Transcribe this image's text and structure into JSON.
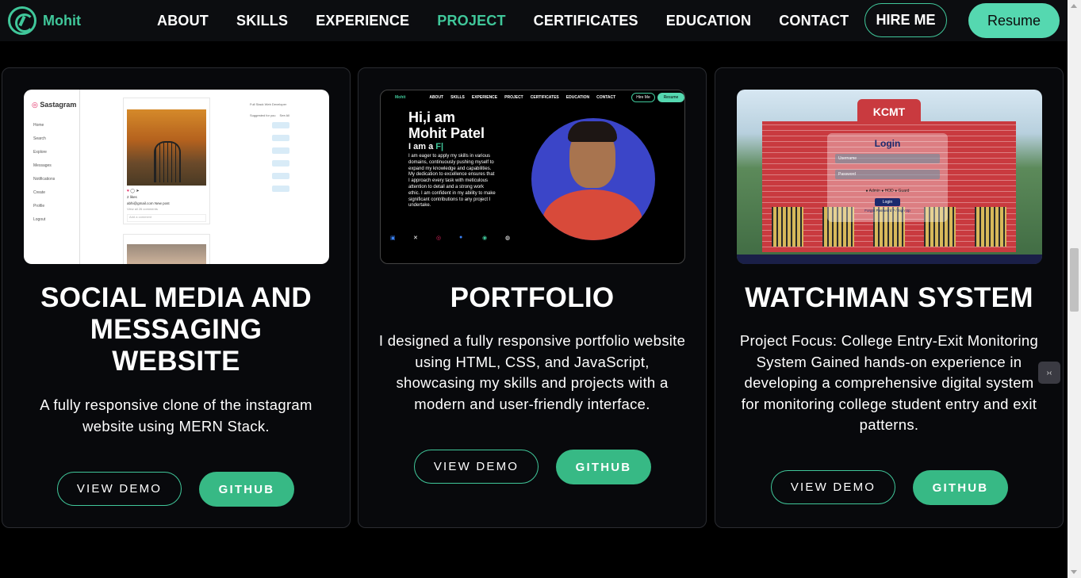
{
  "nav": {
    "logo_text": "Mohit",
    "links": [
      "ABOUT",
      "SKILLS",
      "EXPERIENCE",
      "PROJECT",
      "CERTIFICATES",
      "EDUCATION",
      "CONTACT"
    ],
    "active": "PROJECT",
    "hire_label": "HIRE ME",
    "resume_label": "Resume"
  },
  "projects": [
    {
      "title": "SOCIAL MEDIA AND MESSAGING WEBSITE",
      "description": "A fully responsive clone of the instagram website using MERN Stack.",
      "demo_label": "VIEW DEMO",
      "github_label": "GITHUB",
      "preview": {
        "brand": "Sastagram",
        "menu": [
          "Home",
          "Search",
          "Explore",
          "Messages",
          "Notifications",
          "Create",
          "Profile",
          "Logout"
        ],
        "likes": "2 likes",
        "caption": "abhi@gmail.com New post",
        "comments": "View all 26 comments",
        "add_comment": "Add a comment",
        "suggested": "Suggested for you",
        "see_all": "See All",
        "follow": "Follow",
        "profile_role": "Full Stack Web Developer"
      }
    },
    {
      "title": "PORTFOLIO",
      "description": "I designed a fully responsive portfolio website using HTML, CSS, and JavaScript, showcasing my skills and projects with a modern and user-friendly interface.",
      "demo_label": "VIEW DEMO",
      "github_label": "GITHUB",
      "preview": {
        "brand": "Mohit",
        "links": [
          "ABOUT",
          "SKILLS",
          "EXPERIENCE",
          "PROJECT",
          "CERTIFICATES",
          "EDUCATION",
          "CONTACT"
        ],
        "hire": "Hire Me",
        "resume": "Resume",
        "greeting": "Hi,i am",
        "name": "Mohit Patel",
        "iam": "I am a ",
        "iam_typed": "F|",
        "intro": "I am eager to apply my skills in various domains, continuously pushing myself to expand my knowledge and capabilities. My dedication to excellence ensures that I approach every task with meticulous attention to detail and a strong work ethic. I am confident in my ability to make significant contributions to any project I undertake."
      }
    },
    {
      "title": "WATCHMAN SYSTEM",
      "description": "Project Focus: College Entry-Exit Monitoring System Gained hands-on experience in developing a comprehensive digital system for monitoring college student entry and exit patterns.",
      "demo_label": "VIEW DEMO",
      "github_label": "GITHUB",
      "preview": {
        "sign": "KCMT",
        "login": "Login",
        "username": "Username",
        "password": "Password",
        "roles": "● Admin  ● HOD  ● Guard",
        "button": "Login",
        "forgot": "Forgot Password ? / Sign Up"
      }
    }
  ]
}
